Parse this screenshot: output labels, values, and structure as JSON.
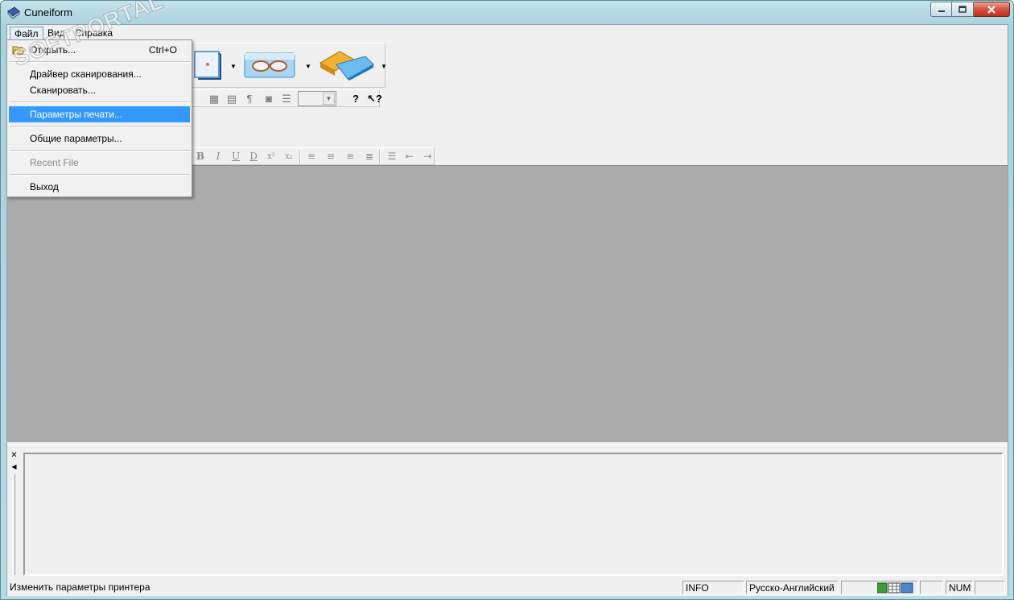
{
  "window": {
    "title": "Cuneiform",
    "controls": [
      "minimize",
      "maximize",
      "close"
    ]
  },
  "menubar": {
    "items": [
      {
        "label": "Файл",
        "active": true
      },
      {
        "label": "Вид",
        "active": false
      },
      {
        "label": "Справка",
        "active": false
      }
    ]
  },
  "file_menu": {
    "items": [
      {
        "label": "Открыть...",
        "shortcut": "Ctrl+O",
        "icon": "open-folder-icon"
      },
      {
        "label": "Драйвер сканирования..."
      },
      {
        "label": "Сканировать..."
      },
      {
        "label": "Параметры печати...",
        "highlighted": true
      },
      {
        "label": "Общие параметры..."
      },
      {
        "label": "Recent File",
        "disabled": true
      },
      {
        "label": "Выход"
      }
    ]
  },
  "toolbar_icons": [
    "document-icon",
    "glasses-recognize-icon",
    "save-send-icon"
  ],
  "format_toolbar": {
    "buttons": [
      "B",
      "I",
      "U",
      "D",
      "x²",
      "x₂"
    ]
  },
  "statusbar": {
    "message": "Изменить параметры принтера",
    "info": "INFO",
    "language": "Русско-Английский",
    "num": "NUM"
  },
  "watermark": "SOFTPORTAL"
}
